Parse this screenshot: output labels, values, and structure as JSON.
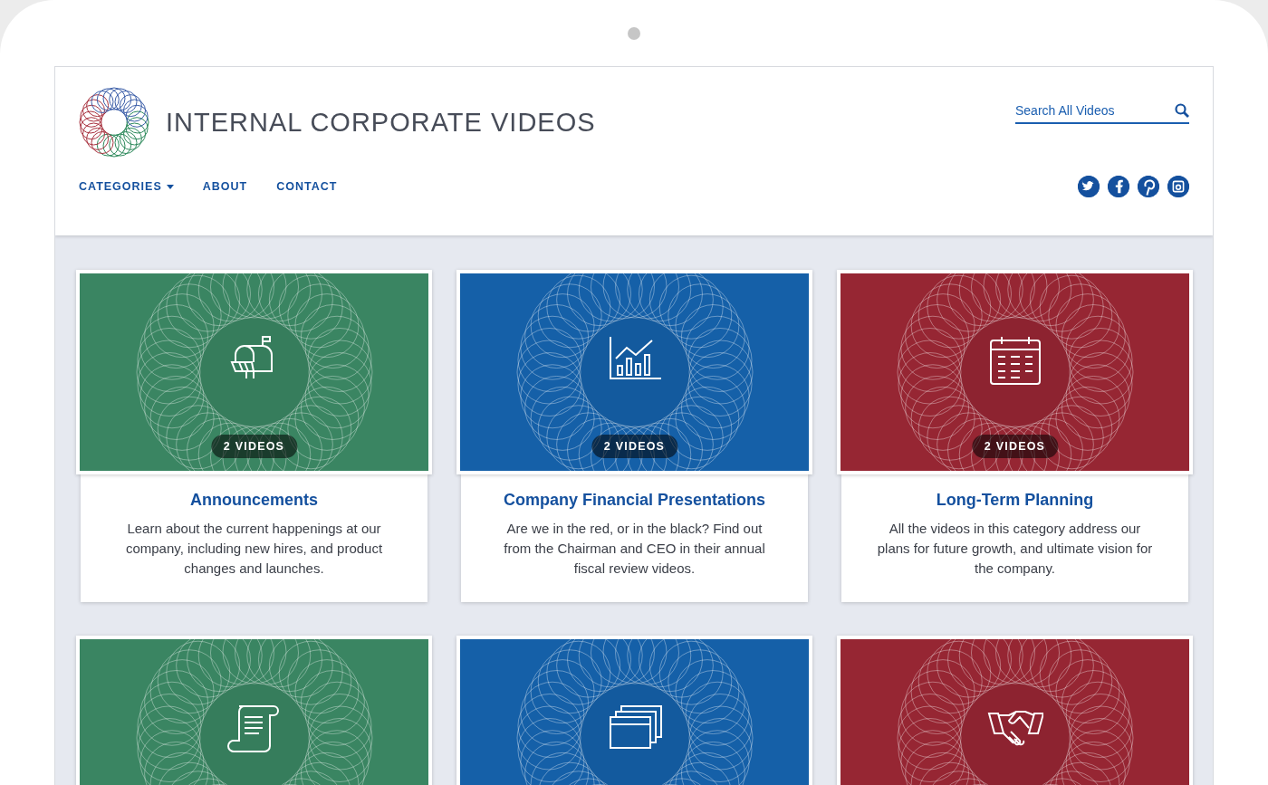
{
  "header": {
    "title": "INTERNAL CORPORATE VIDEOS",
    "search": {
      "placeholder": "Search All Videos"
    },
    "nav": [
      {
        "label": "CATEGORIES",
        "dropdown": true
      },
      {
        "label": "ABOUT",
        "dropdown": false
      },
      {
        "label": "CONTACT",
        "dropdown": false
      }
    ],
    "social": [
      {
        "kind": "twitter"
      },
      {
        "kind": "facebook"
      },
      {
        "kind": "pinterest"
      },
      {
        "kind": "instagram"
      }
    ]
  },
  "categories": [
    {
      "kind": "mailbox",
      "color": "#3a8562",
      "badge": "2 VIDEOS",
      "title": "Announcements",
      "description": "Learn about the current happenings at our company, including new hires, and product changes and launches."
    },
    {
      "kind": "chart",
      "color": "#1560a8",
      "badge": "2 VIDEOS",
      "title": "Company Financial Presentations",
      "description": "Are we in the red, or in the black? Find out from the Chairman and CEO in their annual fiscal review videos."
    },
    {
      "kind": "calendar",
      "color": "#962633",
      "badge": "2 VIDEOS",
      "title": "Long-Term Planning",
      "description": "All the videos in this category address our plans for future growth, and ultimate vision for the company."
    },
    {
      "kind": "scroll",
      "color": "#3a8562"
    },
    {
      "kind": "windows",
      "color": "#1560a8"
    },
    {
      "kind": "handshake",
      "color": "#962633"
    }
  ]
}
